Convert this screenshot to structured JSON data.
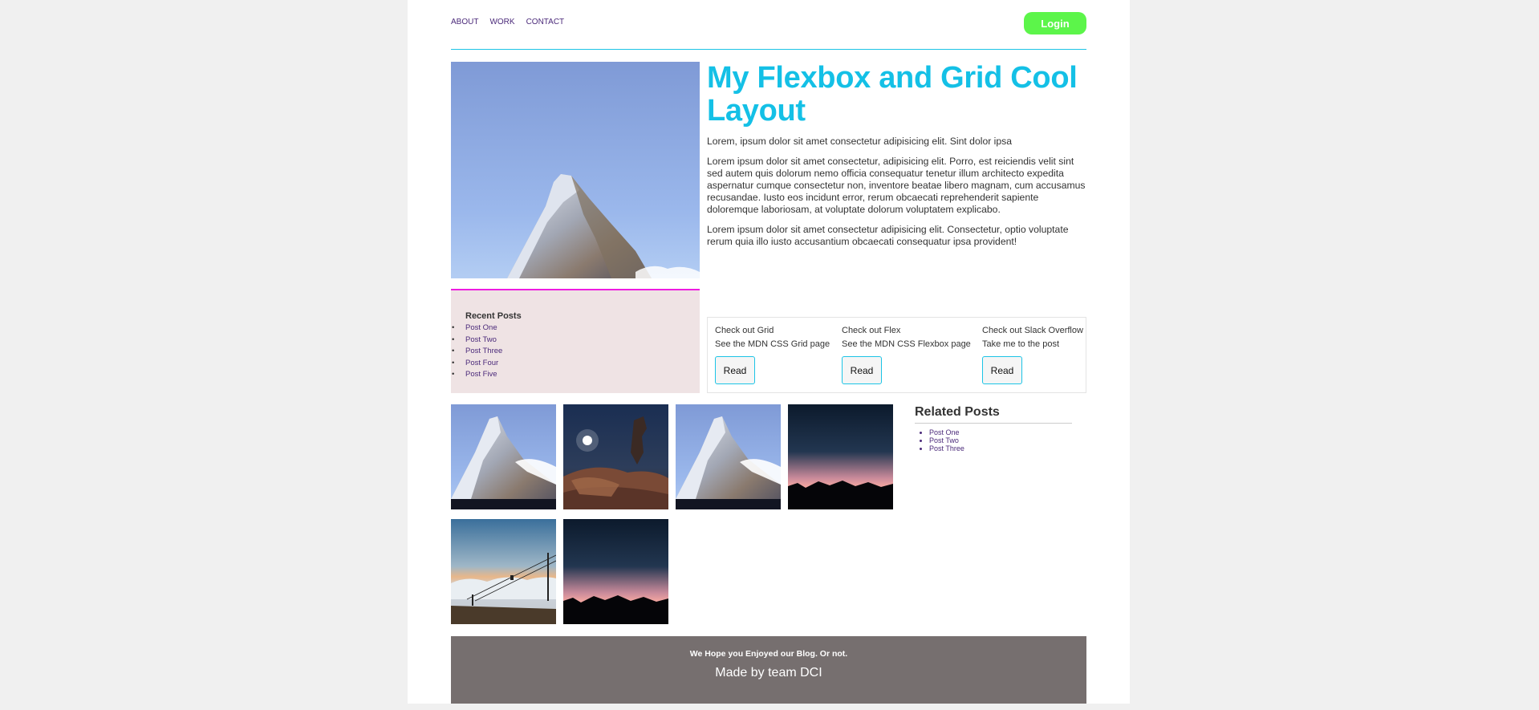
{
  "nav": {
    "items": [
      "ABOUT",
      "WORK",
      "CONTACT"
    ],
    "login_label": "Login"
  },
  "hero": {
    "title": "My Flexbox and Grid Cool Layout",
    "paragraphs": [
      "Lorem, ipsum dolor sit amet consectetur adipisicing elit. Sint dolor ipsa",
      "Lorem ipsum dolor sit amet consectetur, adipisicing elit. Porro, est reiciendis velit sint sed autem quis dolorum nemo officia consequatur tenetur illum architecto expedita aspernatur cumque consectetur non, inventore beatae libero magnam, cum accusamus recusandae. Iusto eos incidunt error, rerum obcaecati reprehenderit sapiente doloremque laboriosam, at voluptate dolorum voluptatem explicabo.",
      "Lorem ipsum dolor sit amet consectetur adipisicing elit. Consectetur, optio voluptate rerum quia illo iusto accusantium obcaecati consequatur ipsa provident!"
    ]
  },
  "recent_posts": {
    "title": "Recent Posts",
    "items": [
      "Post One",
      "Post Two",
      "Post Three",
      "Post Four",
      "Post Five"
    ]
  },
  "cards": [
    {
      "title": "Check out Grid",
      "desc": "See the MDN CSS Grid page",
      "button": "Read"
    },
    {
      "title": "Check out Flex",
      "desc": "See the MDN CSS Flexbox page",
      "button": "Read"
    },
    {
      "title": "Check out Slack Overflow",
      "desc": "Take me to the post",
      "button": "Read"
    }
  ],
  "related_posts": {
    "title": "Related Posts",
    "items": [
      "Post One",
      "Post Two",
      "Post Three"
    ]
  },
  "footer": {
    "line1": "We Hope you Enjoyed our Blog. Or not.",
    "line2": "Made by team DCI"
  },
  "colors": {
    "accent": "#14c0e6",
    "login": "#5cf54a",
    "footer": "#766f6f",
    "recent_bg": "#efe3e4",
    "recent_border": "#ee1ce0"
  }
}
